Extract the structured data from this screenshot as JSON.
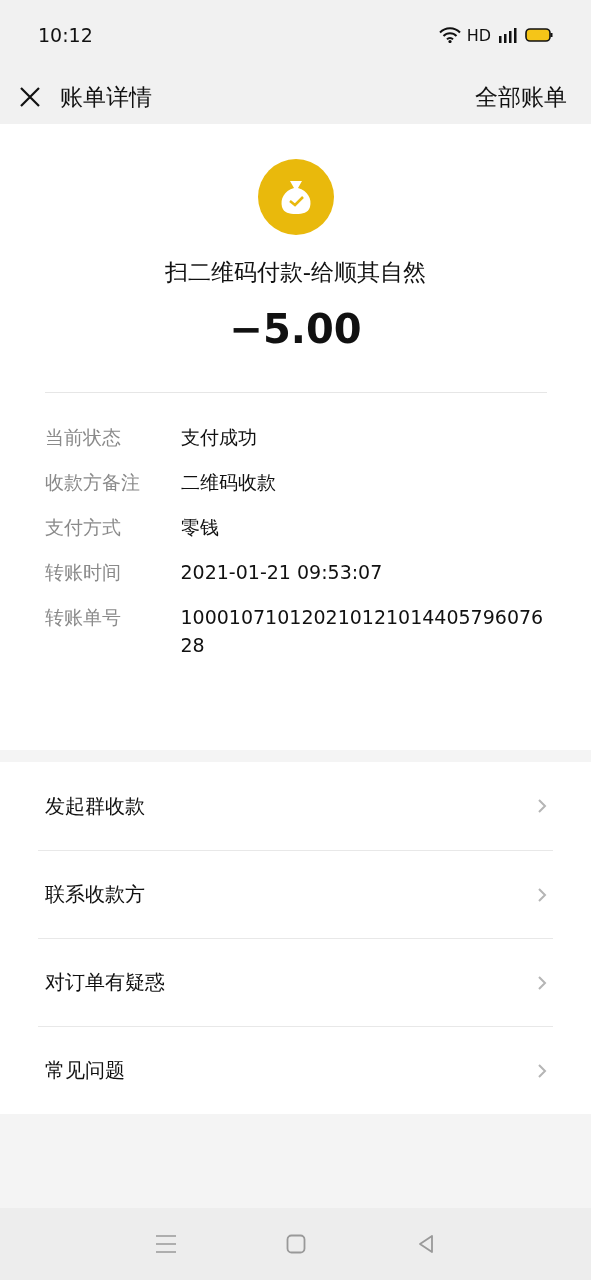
{
  "status_bar": {
    "time": "10:12",
    "network": "HD"
  },
  "header": {
    "title": "账单详情",
    "action": "全部账单"
  },
  "summary": {
    "title": "扫二维码付款-给顺其自然",
    "amount": "−5.00"
  },
  "details": [
    {
      "label": "当前状态",
      "value": "支付成功"
    },
    {
      "label": "收款方备注",
      "value": "二维码收款"
    },
    {
      "label": "支付方式",
      "value": "零钱"
    },
    {
      "label": "转账时间",
      "value": "2021-01-21 09:53:07"
    },
    {
      "label": "转账单号",
      "value": "10001071012021012101440579607628"
    }
  ],
  "actions": [
    "发起群收款",
    "联系收款方",
    "对订单有疑惑",
    "常见问题"
  ]
}
